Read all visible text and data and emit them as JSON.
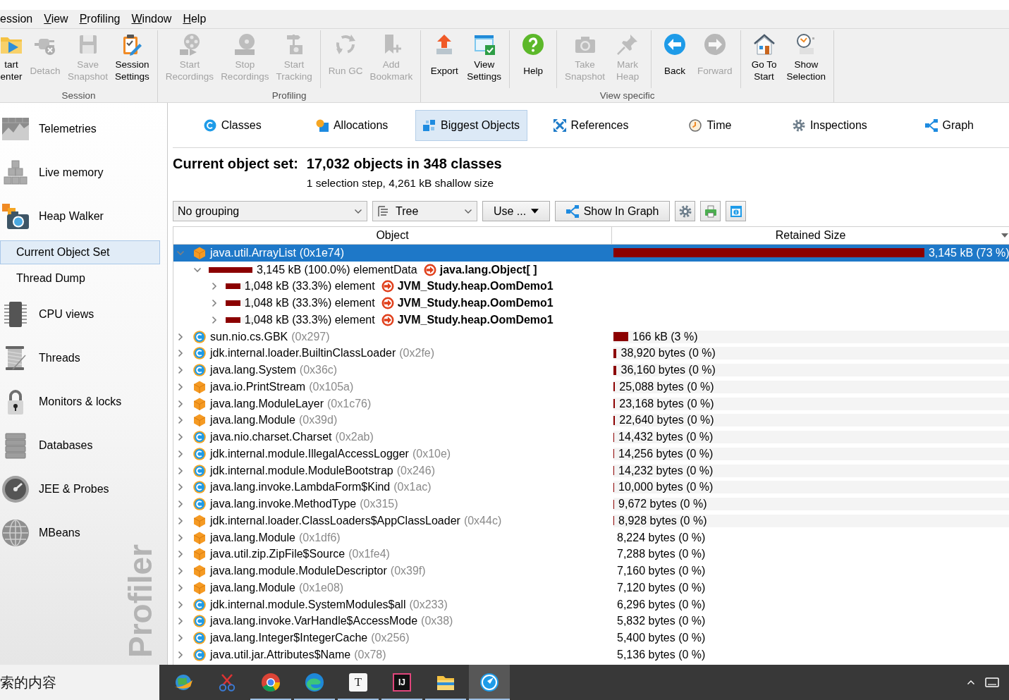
{
  "menu": [
    {
      "label": "ession",
      "mnemonic": false
    },
    {
      "label": "View",
      "mnemonic": true
    },
    {
      "label": "Profiling",
      "mnemonic": true
    },
    {
      "label": "Window",
      "mnemonic": true
    },
    {
      "label": "Help",
      "mnemonic": true
    }
  ],
  "toolbar": {
    "groups": [
      {
        "label": "Session",
        "sections": [
          {
            "buttons": [
              {
                "label": "tart\nenter",
                "disabled": false
              },
              {
                "label": "Detach",
                "disabled": true
              },
              {
                "label": "Save\nSnapshot",
                "disabled": true
              },
              {
                "label": "Session\nSettings",
                "disabled": false
              }
            ]
          }
        ]
      },
      {
        "label": "Profiling",
        "sections": [
          {
            "buttons": [
              {
                "label": "Start\nRecordings",
                "disabled": true
              },
              {
                "label": "Stop\nRecordings",
                "disabled": true
              },
              {
                "label": "Start\nTracking",
                "disabled": true
              }
            ]
          },
          {
            "buttons": [
              {
                "label": "Run GC",
                "disabled": true
              },
              {
                "label": "Add\nBookmark",
                "disabled": true
              }
            ]
          }
        ]
      },
      {
        "label": "View specific",
        "sections": [
          {
            "buttons": [
              {
                "label": "Export",
                "disabled": false
              },
              {
                "label": "View\nSettings",
                "disabled": false
              }
            ]
          },
          {
            "buttons": [
              {
                "label": "Help",
                "disabled": false
              }
            ]
          },
          {
            "buttons": [
              {
                "label": "Take\nSnapshot",
                "disabled": true
              },
              {
                "label": "Mark\nHeap",
                "disabled": true
              }
            ]
          },
          {
            "buttons": [
              {
                "label": "Back",
                "disabled": false
              },
              {
                "label": "Forward",
                "disabled": true
              }
            ]
          },
          {
            "buttons": [
              {
                "label": "Go To\nStart",
                "disabled": false
              },
              {
                "label": "Show\nSelection",
                "disabled": false
              }
            ]
          }
        ]
      }
    ]
  },
  "sidebar": {
    "items": [
      {
        "label": "Telemetries",
        "selected": false
      },
      {
        "label": "Live memory",
        "selected": false
      },
      {
        "label": "Heap Walker",
        "selected": false,
        "children": [
          {
            "label": "Current Object Set",
            "selected": true
          },
          {
            "label": "Thread Dump",
            "selected": false
          }
        ]
      },
      {
        "label": "CPU views",
        "selected": false
      },
      {
        "label": "Threads",
        "selected": false
      },
      {
        "label": "Monitors & locks",
        "selected": false
      },
      {
        "label": "Databases",
        "selected": false
      },
      {
        "label": "JEE & Probes",
        "selected": false
      },
      {
        "label": "MBeans",
        "selected": false
      }
    ],
    "brand": "Profiler"
  },
  "tabs": [
    {
      "label": "Classes",
      "selected": false
    },
    {
      "label": "Allocations",
      "selected": false
    },
    {
      "label": "Biggest Objects",
      "selected": true
    },
    {
      "label": "References",
      "selected": false
    },
    {
      "label": "Time",
      "selected": false
    },
    {
      "label": "Inspections",
      "selected": false
    },
    {
      "label": "Graph",
      "selected": false
    }
  ],
  "summary": {
    "title": "Current object set:",
    "value": "17,032 objects in 348 classes",
    "detail": "1 selection step, 4,261 kB shallow size"
  },
  "controls": {
    "grouping": "No grouping",
    "view": "Tree",
    "use_button": "Use ...",
    "graph_button": "Show In Graph"
  },
  "table": {
    "columns": [
      "Object",
      "Retained Size"
    ],
    "rows": [
      {
        "kind": "object",
        "name": "java.util.ArrayList",
        "address": "(0x1e74)",
        "retained": "3,145 kB (73 %)",
        "level": 0.786,
        "expanded": true,
        "selected": true,
        "children": [
          {
            "kind": "reference",
            "label": "3,145 kB (100.0%) elementData",
            "target": "java.lang.Object[ ]",
            "level": 1,
            "expanded": true,
            "selected": false,
            "children": [
              {
                "kind": "reference",
                "label": "1,048 kB (33.3%) element",
                "target": "JVM_Study.heap.OomDemo1",
                "level": 0.333,
                "expanded": false,
                "selected": false
              },
              {
                "kind": "reference",
                "label": "1,048 kB (33.3%) element",
                "target": "JVM_Study.heap.OomDemo1",
                "level": 0.333,
                "expanded": false,
                "selected": false
              },
              {
                "kind": "reference",
                "label": "1,048 kB (33.3%) element",
                "target": "JVM_Study.heap.OomDemo1",
                "level": 0.333,
                "expanded": false,
                "selected": false
              }
            ]
          }
        ]
      },
      {
        "kind": "class",
        "name": "sun.nio.cs.GBK",
        "address": "(0x297)",
        "retained": "166 kB (3 %)",
        "level": 0.0375,
        "expanded": false,
        "selected": false
      },
      {
        "kind": "class",
        "name": "jdk.internal.loader.BuiltinClassLoader",
        "address": "(0x2fe)",
        "retained": "38,920 bytes (0 %)",
        "level": 0.008,
        "expanded": false,
        "selected": false
      },
      {
        "kind": "class",
        "name": "java.lang.System",
        "address": "(0x36c)",
        "retained": "36,160 bytes (0 %)",
        "level": 0.008,
        "expanded": false,
        "selected": false
      },
      {
        "kind": "object",
        "name": "java.io.PrintStream",
        "address": "(0x105a)",
        "retained": "25,088 bytes (0 %)",
        "level": 0.004,
        "expanded": false,
        "selected": false
      },
      {
        "kind": "object",
        "name": "java.lang.ModuleLayer",
        "address": "(0x1c76)",
        "retained": "23,168 bytes (0 %)",
        "level": 0.004,
        "expanded": false,
        "selected": false
      },
      {
        "kind": "object",
        "name": "java.lang.Module",
        "address": "(0x39d)",
        "retained": "22,640 bytes (0 %)",
        "level": 0.004,
        "expanded": false,
        "selected": false
      },
      {
        "kind": "class",
        "name": "java.nio.charset.Charset",
        "address": "(0x2ab)",
        "retained": "14,432 bytes (0 %)",
        "level": 0.002,
        "expanded": false,
        "selected": false
      },
      {
        "kind": "class",
        "name": "jdk.internal.module.IllegalAccessLogger",
        "address": "(0x10e)",
        "retained": "14,256 bytes (0 %)",
        "level": 0.002,
        "expanded": false,
        "selected": false
      },
      {
        "kind": "class",
        "name": "jdk.internal.module.ModuleBootstrap",
        "address": "(0x246)",
        "retained": "14,232 bytes (0 %)",
        "level": 0.002,
        "expanded": false,
        "selected": false
      },
      {
        "kind": "class",
        "name": "java.lang.invoke.LambdaForm$Kind",
        "address": "(0x1ac)",
        "retained": "10,000 bytes (0 %)",
        "level": 0.002,
        "expanded": false,
        "selected": false
      },
      {
        "kind": "class",
        "name": "java.lang.invoke.MethodType",
        "address": "(0x315)",
        "retained": "9,672 bytes (0 %)",
        "level": 0.002,
        "expanded": false,
        "selected": false
      },
      {
        "kind": "object",
        "name": "jdk.internal.loader.ClassLoaders$AppClassLoader",
        "address": "(0x44c)",
        "retained": "8,928 bytes (0 %)",
        "level": 0.002,
        "expanded": false,
        "selected": false
      },
      {
        "kind": "object",
        "name": "java.lang.Module",
        "address": "(0x1df6)",
        "retained": "8,224 bytes (0 %)",
        "expanded": false,
        "selected": false
      },
      {
        "kind": "object",
        "name": "java.util.zip.ZipFile$Source",
        "address": "(0x1fe4)",
        "retained": "7,288 bytes (0 %)",
        "expanded": false,
        "selected": false
      },
      {
        "kind": "object",
        "name": "java.lang.module.ModuleDescriptor",
        "address": "(0x39f)",
        "retained": "7,160 bytes (0 %)",
        "expanded": false,
        "selected": false
      },
      {
        "kind": "object",
        "name": "java.lang.Module",
        "address": "(0x1e08)",
        "retained": "7,120 bytes (0 %)",
        "expanded": false,
        "selected": false
      },
      {
        "kind": "class",
        "name": "jdk.internal.module.SystemModules$all",
        "address": "(0x233)",
        "retained": "6,296 bytes (0 %)",
        "expanded": false,
        "selected": false
      },
      {
        "kind": "class",
        "name": "java.lang.invoke.VarHandle$AccessMode",
        "address": "(0x38)",
        "retained": "5,832 bytes (0 %)",
        "expanded": false,
        "selected": false
      },
      {
        "kind": "class",
        "name": "java.lang.Integer$IntegerCache",
        "address": "(0x256)",
        "retained": "5,400 bytes (0 %)",
        "expanded": false,
        "selected": false
      },
      {
        "kind": "class",
        "name": "java.util.jar.Attributes$Name",
        "address": "(0x78)",
        "retained": "5,136 bytes (0 %)",
        "expanded": false,
        "selected": false
      }
    ]
  },
  "taskbar": {
    "search": {
      "placeholder": "索的内容"
    },
    "apps": [
      {
        "running": false,
        "selected": false
      },
      {
        "running": false,
        "selected": false
      },
      {
        "running": true,
        "selected": false
      },
      {
        "running": true,
        "selected": false
      },
      {
        "glyph": "T",
        "running": true,
        "selected": false
      },
      {
        "glyph": "IJ",
        "running": true,
        "selected": false
      },
      {
        "running": true,
        "selected": false
      },
      {
        "running": true,
        "selected": true
      }
    ]
  }
}
